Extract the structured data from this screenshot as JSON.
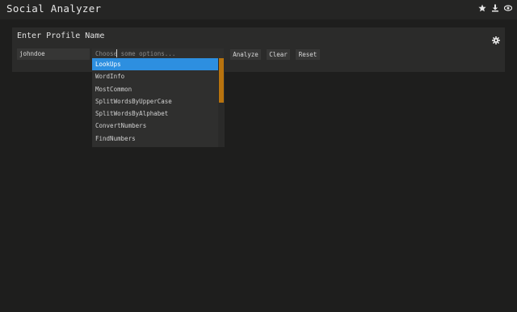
{
  "app": {
    "title": "Social Analyzer"
  },
  "top_icons": [
    "star-icon",
    "download-icon",
    "eye-icon"
  ],
  "panel": {
    "title": "Enter Profile Name",
    "settings_icon": "gear-icon"
  },
  "profile_input": {
    "value": "johndoe"
  },
  "options": {
    "placeholder": "Choose some options...",
    "items": [
      "LookUps",
      "WordInfo",
      "MostCommon",
      "SplitWordsByUpperCase",
      "SplitWordsByAlphabet",
      "ConvertNumbers",
      "FindNumbers"
    ],
    "selected_index": 0,
    "scroll_position": 0.0,
    "scroll_visible_fraction": 0.5
  },
  "buttons": {
    "analyze": "Analyze",
    "clear": "Clear",
    "reset": "Reset"
  },
  "colors": {
    "background": "#1e1e1d",
    "panel": "#2b2b2a",
    "selected": "#2d8fe0",
    "scroll_thumb": "#b8730e"
  }
}
